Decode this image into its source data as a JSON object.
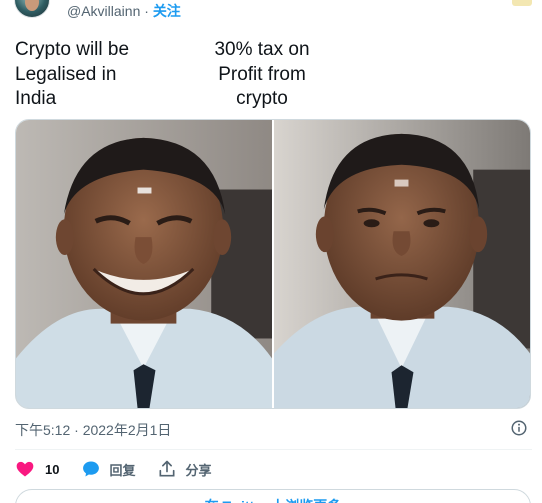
{
  "header": {
    "handle": "@Akvillainn",
    "separator": " · ",
    "follow_label": "关注"
  },
  "captions": {
    "left": "Crypto will be\nLegalised in\nIndia",
    "right": "30% tax on\nProfit from\ncrypto"
  },
  "meta": {
    "timestamp": "下午5:12 · 2022年2月1日"
  },
  "actions": {
    "like_count": "10",
    "reply_label": "回复",
    "share_label": "分享"
  },
  "more_button": {
    "label": "在 Twitter 上浏览更多"
  },
  "colors": {
    "like": "#f91880",
    "reply": "#1d9bf0",
    "link": "#1d9bf0",
    "muted": "#536471"
  },
  "icons": [
    "avatar-image",
    "info-icon",
    "heart-icon",
    "reply-bubble-icon",
    "share-icon"
  ]
}
